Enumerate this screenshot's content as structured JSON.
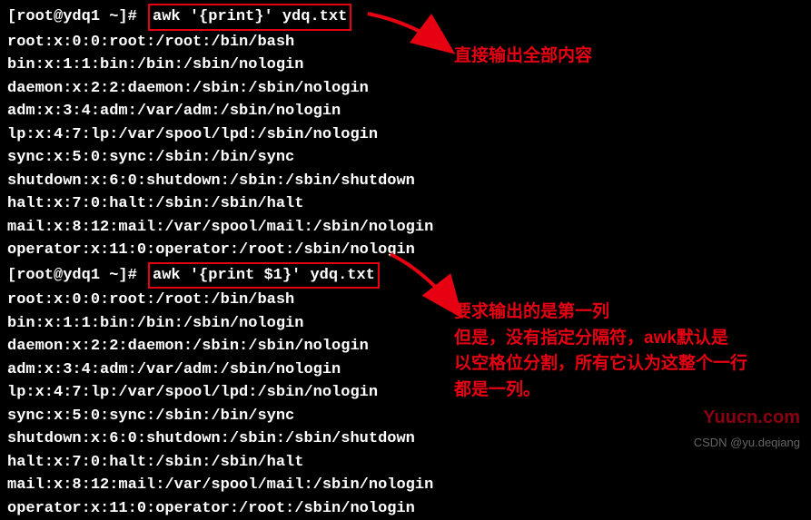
{
  "prompt": "[root@ydq1 ~]# ",
  "commands": {
    "cmd1": "awk '{print}' ydq.txt",
    "cmd2": "awk '{print $1}' ydq.txt"
  },
  "output1": [
    "root:x:0:0:root:/root:/bin/bash",
    "bin:x:1:1:bin:/bin:/sbin/nologin",
    "daemon:x:2:2:daemon:/sbin:/sbin/nologin",
    "adm:x:3:4:adm:/var/adm:/sbin/nologin",
    "lp:x:4:7:lp:/var/spool/lpd:/sbin/nologin",
    "sync:x:5:0:sync:/sbin:/bin/sync",
    "shutdown:x:6:0:shutdown:/sbin:/sbin/shutdown",
    "halt:x:7:0:halt:/sbin:/sbin/halt",
    "mail:x:8:12:mail:/var/spool/mail:/sbin/nologin",
    "operator:x:11:0:operator:/root:/sbin/nologin"
  ],
  "output2": [
    "root:x:0:0:root:/root:/bin/bash",
    "bin:x:1:1:bin:/bin:/sbin/nologin",
    "daemon:x:2:2:daemon:/sbin:/sbin/nologin",
    "adm:x:3:4:adm:/var/adm:/sbin/nologin",
    "lp:x:4:7:lp:/var/spool/lpd:/sbin/nologin",
    "sync:x:5:0:sync:/sbin:/bin/sync",
    "shutdown:x:6:0:shutdown:/sbin:/sbin/shutdown",
    "halt:x:7:0:halt:/sbin:/sbin/halt",
    "mail:x:8:12:mail:/var/spool/mail:/sbin/nologin",
    "operator:x:11:0:operator:/root:/sbin/nologin"
  ],
  "annotations": {
    "note1": "直接输出全部内容",
    "note2_l1": "要求输出的是第一列",
    "note2_l2": "但是，没有指定分隔符，awk默认是",
    "note2_l3": "以空格位分割，所有它认为这整个一行",
    "note2_l4": "都是一列。"
  },
  "watermarks": {
    "w1": "Yuucn.com",
    "w2": "CSDN @yu.deqiang"
  }
}
